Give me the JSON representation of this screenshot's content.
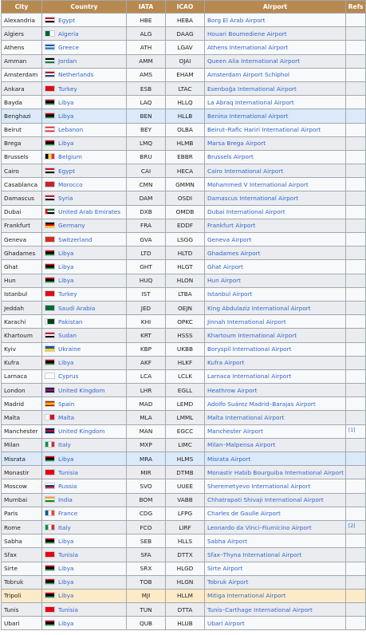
{
  "headers": [
    "City",
    "Country",
    "IATA",
    "ICAO",
    "Airport",
    "Refs"
  ],
  "rows": [
    {
      "city": "Alexandria",
      "country": "Egypt",
      "iata": "HBE",
      "icao": "HEBA",
      "airport": "Borg El Arab Airport",
      "flag": "linear-gradient(#ce1126 33%,#fff 33% 66%,#000 66%)"
    },
    {
      "city": "Algiers",
      "country": "Algeria",
      "iata": "ALG",
      "icao": "DAAG",
      "airport": "Houari Boumediene Airport",
      "flag": "linear-gradient(90deg,#006233 50%,#fff 50%)"
    },
    {
      "city": "Athens",
      "country": "Greece",
      "iata": "ATH",
      "icao": "LGAV",
      "airport": "Athens International Airport",
      "flag": "repeating-linear-gradient(#0d5eaf 0 1.8px,#fff 1.8px 3.6px)"
    },
    {
      "city": "Amman",
      "country": "Jordan",
      "iata": "AMM",
      "icao": "OJAI",
      "airport": "Queen Alia International Airport",
      "flag": "linear-gradient(#000 33%,#fff 33% 66%,#007a3d 66%)"
    },
    {
      "city": "Amsterdam",
      "country": "Netherlands",
      "iata": "AMS",
      "icao": "EHAM",
      "airport": "Amsterdam Airport Schiphol",
      "flag": "linear-gradient(#ae1c28 33%,#fff 33% 66%,#21468b 66%)"
    },
    {
      "city": "Ankara",
      "country": "Turkey",
      "iata": "ESB",
      "icao": "LTAC",
      "airport": "Esenboğa International Airport",
      "flag": "#e30a17"
    },
    {
      "city": "Bayda",
      "country": "Libya",
      "iata": "LAQ",
      "icao": "HLLQ",
      "airport": "La Abraq International Airport",
      "flag": "linear-gradient(#e70013 25%,#000 25% 75%,#239e46 75%)"
    },
    {
      "city": "Benghazi",
      "country": "Libya",
      "iata": "BEN",
      "icao": "HLLB",
      "airport": "Benina International Airport",
      "flag": "linear-gradient(#e70013 25%,#000 25% 75%,#239e46 75%)",
      "highlight": "blue"
    },
    {
      "city": "Beirut",
      "country": "Lebanon",
      "iata": "BEY",
      "icao": "OLBA",
      "airport": "Beirut–Rafic Hariri International Airport",
      "flag": "linear-gradient(#ed1c24 25%,#fff 25% 75%,#ed1c24 75%)"
    },
    {
      "city": "Brega",
      "country": "Libya",
      "iata": "LMQ",
      "icao": "HLMB",
      "airport": "Marsa Brega Airport",
      "flag": "linear-gradient(#e70013 25%,#000 25% 75%,#239e46 75%)"
    },
    {
      "city": "Brussels",
      "country": "Belgium",
      "iata": "BRU",
      "icao": "EBBR",
      "airport": "Brussels Airport",
      "flag": "linear-gradient(90deg,#000 33%,#fae042 33% 66%,#ed2939 66%)"
    },
    {
      "city": "Cairo",
      "country": "Egypt",
      "iata": "CAI",
      "icao": "HECA",
      "airport": "Cairo International Airport",
      "flag": "linear-gradient(#ce1126 33%,#fff 33% 66%,#000 66%)"
    },
    {
      "city": "Casablanca",
      "country": "Morocco",
      "iata": "CMN",
      "icao": "GMMN",
      "airport": "Mohammed V International Airport",
      "flag": "#c1272d"
    },
    {
      "city": "Damascus",
      "country": "Syria",
      "iata": "DAM",
      "icao": "OSDI",
      "airport": "Damascus International Airport",
      "flag": "linear-gradient(#ce1126 33%,#fff 33% 66%,#000 66%)"
    },
    {
      "city": "Dubai",
      "country": "United Arab Emirates",
      "iata": "DXB",
      "icao": "OMDB",
      "airport": "Dubai International Airport",
      "flag": "linear-gradient(90deg,#ff0000 25%,transparent 25%),linear-gradient(#00732f 33%,#fff 33% 66%,#000 66%)"
    },
    {
      "city": "Frankfurt",
      "country": "Germany",
      "iata": "FRA",
      "icao": "EDDF",
      "airport": "Frankfurt Airport",
      "flag": "linear-gradient(#000 33%,#dd0000 33% 66%,#ffce00 66%)"
    },
    {
      "city": "Geneva",
      "country": "Switzerland",
      "iata": "GVA",
      "icao": "LSGG",
      "airport": "Geneva Airport",
      "flag": "#d52b1e"
    },
    {
      "city": "Ghadames",
      "country": "Libya",
      "iata": "LTD",
      "icao": "HLTD",
      "airport": "Ghadames Airport",
      "flag": "linear-gradient(#e70013 25%,#000 25% 75%,#239e46 75%)"
    },
    {
      "city": "Ghat",
      "country": "Libya",
      "iata": "GHT",
      "icao": "HLGT",
      "airport": "Ghat Airport",
      "flag": "linear-gradient(#e70013 25%,#000 25% 75%,#239e46 75%)"
    },
    {
      "city": "Hun",
      "country": "Libya",
      "iata": "HUQ",
      "icao": "HLON",
      "airport": "Hun Airport",
      "flag": "linear-gradient(#e70013 25%,#000 25% 75%,#239e46 75%)"
    },
    {
      "city": "Istanbul",
      "country": "Turkey",
      "iata": "IST",
      "icao": "LTBA",
      "airport": "Istanbul Airport",
      "flag": "#e30a17"
    },
    {
      "city": "Jeddah",
      "country": "Saudi Arabia",
      "iata": "JED",
      "icao": "OEJN",
      "airport": "King Abdulaziz International Airport",
      "flag": "#006c35"
    },
    {
      "city": "Karachi",
      "country": "Pakistan",
      "iata": "KHI",
      "icao": "OPKC",
      "airport": "Jinnah International Airport",
      "flag": "linear-gradient(90deg,#fff 25%,#01411c 25%)"
    },
    {
      "city": "Khartoum",
      "country": "Sudan",
      "iata": "KRT",
      "icao": "HSSS",
      "airport": "Khartoum International Airport",
      "flag": "linear-gradient(#d21034 33%,#fff 33% 66%,#000 66%)"
    },
    {
      "city": "Kyiv",
      "country": "Ukraine",
      "iata": "KBP",
      "icao": "UKBB",
      "airport": "Boryspil International Airport",
      "flag": "linear-gradient(#0057b7 50%,#ffd700 50%)"
    },
    {
      "city": "Kufra",
      "country": "Libya",
      "iata": "AKF",
      "icao": "HLKF",
      "airport": "Kufra Airport",
      "flag": "linear-gradient(#e70013 25%,#000 25% 75%,#239e46 75%)"
    },
    {
      "city": "Larnaca",
      "country": "Cyprus",
      "iata": "LCA",
      "icao": "LCLK",
      "airport": "Larnaca International Airport",
      "flag": "#ffffff"
    },
    {
      "city": "London",
      "country": "United Kingdom",
      "iata": "LHR",
      "icao": "EGLL",
      "airport": "Heathrow Airport",
      "flag": "linear-gradient(#012169 35%,#c8102e 35% 65%,#012169 65%)"
    },
    {
      "city": "Madrid",
      "country": "Spain",
      "iata": "MAD",
      "icao": "LEMD",
      "airport": "Adolfo Suárez Madrid–Barajas Airport",
      "flag": "linear-gradient(#aa151b 25%,#f1bf00 25% 75%,#aa151b 75%)"
    },
    {
      "city": "Malta",
      "country": "Malta",
      "iata": "MLA",
      "icao": "LMML",
      "airport": "Malta International Airport",
      "flag": "linear-gradient(90deg,#fff 50%,#cf142b 50%)"
    },
    {
      "city": "Manchester",
      "country": "United Kingdom",
      "iata": "MAN",
      "icao": "EGCC",
      "airport": "Manchester Airport",
      "flag": "linear-gradient(#012169 35%,#c8102e 35% 65%,#012169 65%)",
      "ref": "[1]"
    },
    {
      "city": "Milan",
      "country": "Italy",
      "iata": "MXP",
      "icao": "LIMC",
      "airport": "Milan–Malpensa Airport",
      "flag": "linear-gradient(90deg,#009246 33%,#fff 33% 66%,#ce2b37 66%)"
    },
    {
      "city": "Misrata",
      "country": "Libya",
      "iata": "MRA",
      "icao": "HLMS",
      "airport": "Misrata Airport",
      "flag": "linear-gradient(#e70013 25%,#000 25% 75%,#239e46 75%)",
      "highlight": "blue"
    },
    {
      "city": "Monastir",
      "country": "Tunisia",
      "iata": "MIR",
      "icao": "DTMB",
      "airport": "Monastir Habib Bourguiba International Airport",
      "flag": "#e70013"
    },
    {
      "city": "Moscow",
      "country": "Russia",
      "iata": "SVO",
      "icao": "UUEE",
      "airport": "Sheremetyevo International Airport",
      "flag": "linear-gradient(#fff 33%,#0039a6 33% 66%,#d52b1e 66%)"
    },
    {
      "city": "Mumbai",
      "country": "India",
      "iata": "BOM",
      "icao": "VABB",
      "airport": "Chhatrapati Shivaji International Airport",
      "flag": "linear-gradient(#ff9933 33%,#fff 33% 66%,#138808 66%)"
    },
    {
      "city": "Paris",
      "country": "France",
      "iata": "CDG",
      "icao": "LFPG",
      "airport": "Charles de Gaulle Airport",
      "flag": "linear-gradient(90deg,#0055a4 33%,#fff 33% 66%,#ef4135 66%)"
    },
    {
      "city": "Rome",
      "country": "Italy",
      "iata": "FCO",
      "icao": "LIRF",
      "airport": "Leonardo da Vinci–Fiumicino Airport",
      "flag": "linear-gradient(90deg,#009246 33%,#fff 33% 66%,#ce2b37 66%)",
      "ref": "[2]"
    },
    {
      "city": "Sabha",
      "country": "Libya",
      "iata": "SEB",
      "icao": "HLLS",
      "airport": "Sabha Airport",
      "flag": "linear-gradient(#e70013 25%,#000 25% 75%,#239e46 75%)"
    },
    {
      "city": "Sfax",
      "country": "Tunisia",
      "iata": "SFA",
      "icao": "DTTX",
      "airport": "Sfax–Thyna International Airport",
      "flag": "#e70013"
    },
    {
      "city": "Sirte",
      "country": "Libya",
      "iata": "SRX",
      "icao": "HLGD",
      "airport": "Sirte Airport",
      "flag": "linear-gradient(#e70013 25%,#000 25% 75%,#239e46 75%)"
    },
    {
      "city": "Tobruk",
      "country": "Libya",
      "iata": "TOB",
      "icao": "HLGN",
      "airport": "Tobruk Airport",
      "flag": "linear-gradient(#e70013 25%,#000 25% 75%,#239e46 75%)"
    },
    {
      "city": "Tripoli",
      "country": "Libya",
      "iata": "MJI",
      "icao": "HLLM",
      "airport": "Mitiga International Airport",
      "flag": "linear-gradient(#e70013 25%,#000 25% 75%,#239e46 75%)",
      "highlight": "yellow"
    },
    {
      "city": "Tunis",
      "country": "Tunisia",
      "iata": "TUN",
      "icao": "DTTA",
      "airport": "Tunis–Carthage International Airport",
      "flag": "#e70013"
    },
    {
      "city": "Ubari",
      "country": "Libya",
      "iata": "QUB",
      "icao": "HLUB",
      "airport": "Ubari Airport",
      "flag": "linear-gradient(#e70013 25%,#000 25% 75%,#239e46 75%)"
    }
  ]
}
